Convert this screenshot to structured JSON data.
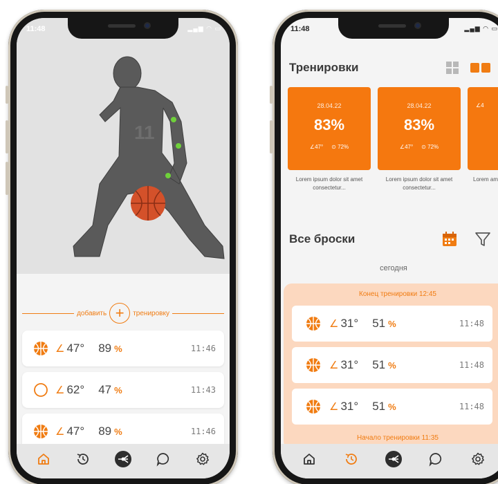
{
  "status_bar": {
    "time": "11:48",
    "icons": "▂▄▆ ◠ ▭"
  },
  "left_phone": {
    "add_row": {
      "left_label": "добавить",
      "plus_symbol": "+",
      "right_label": "тренировку"
    },
    "shots": [
      {
        "icon": "basketball-icon",
        "angle_icon": "∠",
        "angle": "47",
        "degree": "°",
        "percent": "89",
        "percent_sign": "%",
        "time": "11:46"
      },
      {
        "icon": "circle-outline-icon",
        "angle_icon": "∠",
        "angle": "62",
        "degree": "°",
        "percent": "47",
        "percent_sign": "%",
        "time": "11:43"
      },
      {
        "icon": "basketball-icon",
        "angle_icon": "∠",
        "angle": "47",
        "degree": "°",
        "percent": "89",
        "percent_sign": "%",
        "time": "11:46"
      }
    ],
    "tabbar": [
      "home-icon",
      "history-icon",
      "shoot-icon",
      "chat-icon",
      "settings-icon"
    ],
    "active_tab": "home-icon",
    "number_on_jersey": "11"
  },
  "right_phone": {
    "trainings_title": "Тренировки",
    "view_toggle": [
      "grid-view-icon",
      "list-view-icon"
    ],
    "training_cards": [
      {
        "date": "28.04.22",
        "percent": "83%",
        "angle": "∠47°",
        "accuracy": "⊙ 72%",
        "caption": "Lorem ipsum dolor sit amet consectetur..."
      },
      {
        "date": "28.04.22",
        "percent": "83%",
        "angle": "∠47°",
        "accuracy": "⊙ 72%",
        "caption": "Lorem ipsum dolor sit amet consectetur..."
      },
      {
        "date": "",
        "percent": "",
        "angle": "∠4",
        "accuracy": "",
        "caption": "Lorem am"
      }
    ],
    "all_shots_title": "Все броски",
    "today_label": "сегодня",
    "session_end": "Конец тренировки 12:45",
    "session_start": "Начало тренировки 11:35",
    "shots": [
      {
        "icon": "basketball-icon",
        "angle_icon": "∠",
        "angle": "31",
        "degree": "°",
        "percent": "51",
        "percent_sign": "%",
        "time": "11:48"
      },
      {
        "icon": "basketball-icon",
        "angle_icon": "∠",
        "angle": "31",
        "degree": "°",
        "percent": "51",
        "percent_sign": "%",
        "time": "11:48"
      },
      {
        "icon": "basketball-icon",
        "angle_icon": "∠",
        "angle": "31",
        "degree": "°",
        "percent": "51",
        "percent_sign": "%",
        "time": "11:48"
      }
    ],
    "active_tab": "history-icon"
  },
  "colors": {
    "accent": "#f07c12",
    "card_orange": "#f5780f",
    "session_bg": "#fcd8bf",
    "screen_bg": "#f4f4f4"
  }
}
